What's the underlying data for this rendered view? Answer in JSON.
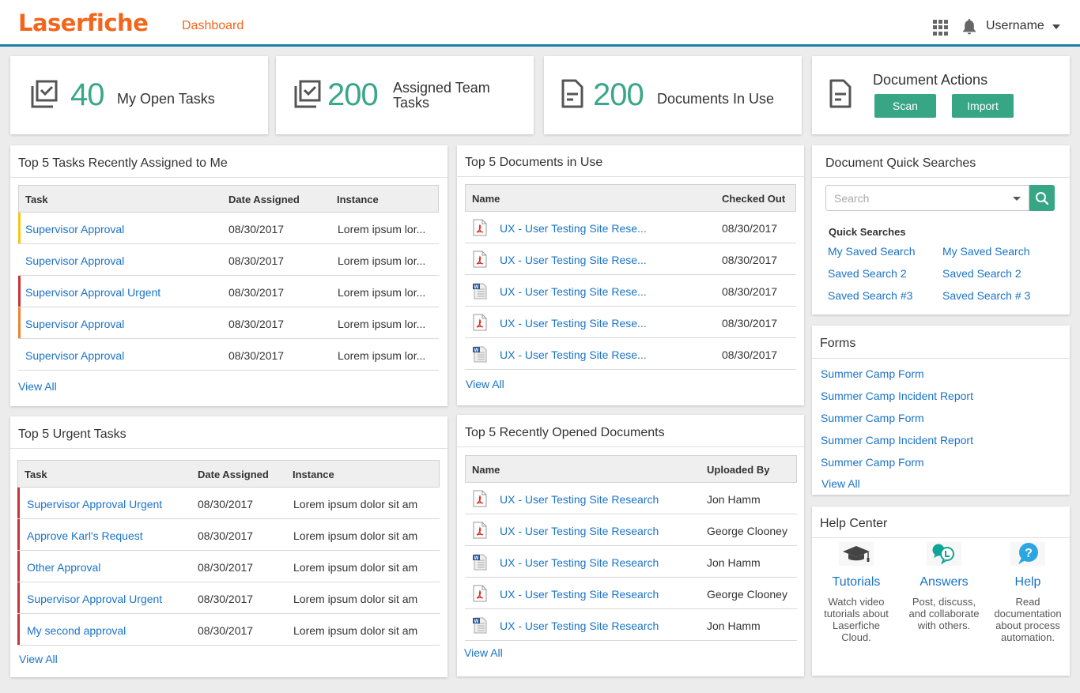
{
  "header": {
    "logo": "Laserfiche",
    "nav_dashboard": "Dashboard",
    "apps_icon": "apps-grid-icon",
    "notifications_icon": "bell-icon",
    "username": "Username"
  },
  "colors": {
    "brand_orange": "#f2661b",
    "accent_green": "#37a685",
    "stat_green": "#3aa68a",
    "link_blue": "#1a73c8",
    "header_border": "#1d7fa6",
    "priority_yellow": "#f5c518",
    "priority_red": "#c8333a",
    "priority_orange": "#f0822d"
  },
  "stats": [
    {
      "icon": "checkbox-tasks-icon",
      "number": "40",
      "label": "My Open Tasks"
    },
    {
      "icon": "checkbox-tasks-icon",
      "number": "200",
      "label_line1": "Assigned Team",
      "label_line2": "Tasks"
    },
    {
      "icon": "document-icon",
      "number": "200",
      "label": "Documents In Use"
    }
  ],
  "document_actions": {
    "icon": "document-icon",
    "title": "Document Actions",
    "scan_label": "Scan",
    "import_label": "Import"
  },
  "recent_tasks": {
    "title": "Top 5 Tasks Recently Assigned to Me",
    "columns": [
      "Task",
      "Date Assigned",
      "Instance"
    ],
    "rows": [
      {
        "task": "Supervisor Approval",
        "date": "08/30/2017",
        "instance": "Lorem ipsum lor...",
        "priority": "yellow"
      },
      {
        "task": "Supervisor Approval",
        "date": "08/30/2017",
        "instance": "Lorem ipsum lor...",
        "priority": "none"
      },
      {
        "task": "Supervisor Approval Urgent",
        "date": "08/30/2017",
        "instance": "Lorem ipsum lor...",
        "priority": "red"
      },
      {
        "task": "Supervisor Approval",
        "date": "08/30/2017",
        "instance": "Lorem ipsum lor...",
        "priority": "orange"
      },
      {
        "task": "Supervisor Approval",
        "date": "08/30/2017",
        "instance": "Lorem ipsum lor...",
        "priority": "none"
      }
    ],
    "view_all": "View All"
  },
  "docs_in_use": {
    "title": "Top 5 Documents in Use",
    "columns": [
      "Name",
      "Checked Out"
    ],
    "rows": [
      {
        "type": "pdf",
        "name": "UX - User Testing Site Rese...",
        "checked_out": "08/30/2017"
      },
      {
        "type": "pdf",
        "name": "UX - User Testing Site Rese...",
        "checked_out": "08/30/2017"
      },
      {
        "type": "word",
        "name": "UX - User Testing Site Rese...",
        "checked_out": "08/30/2017"
      },
      {
        "type": "pdf",
        "name": "UX - User Testing Site Rese...",
        "checked_out": "08/30/2017"
      },
      {
        "type": "word",
        "name": "UX - User Testing Site Rese...",
        "checked_out": "08/30/2017"
      }
    ],
    "view_all": "View All"
  },
  "urgent_tasks": {
    "title": "Top 5 Urgent Tasks",
    "columns": [
      "Task",
      "Date Assigned",
      "Instance"
    ],
    "rows": [
      {
        "task": "Supervisor Approval Urgent",
        "date": "08/30/2017",
        "instance": "Lorem ipsum dolor sit am",
        "priority": "red"
      },
      {
        "task": "Approve Karl's Request",
        "date": "08/30/2017",
        "instance": "Lorem ipsum dolor sit am",
        "priority": "red"
      },
      {
        "task": "Other Approval",
        "date": "08/30/2017",
        "instance": "Lorem ipsum dolor sit am",
        "priority": "red"
      },
      {
        "task": "Supervisor Approval Urgent",
        "date": "08/30/2017",
        "instance": "Lorem ipsum dolor sit am",
        "priority": "red"
      },
      {
        "task": "My second approval",
        "date": "08/30/2017",
        "instance": "Lorem ipsum dolor sit am",
        "priority": "red"
      }
    ],
    "view_all": "View All"
  },
  "recent_docs": {
    "title": "Top 5 Recently Opened Documents",
    "columns": [
      "Name",
      "Uploaded By"
    ],
    "rows": [
      {
        "type": "pdf",
        "name": "UX - User Testing Site Research",
        "uploaded_by": "Jon Hamm"
      },
      {
        "type": "pdf",
        "name": "UX - User Testing Site Research",
        "uploaded_by": "George Clooney"
      },
      {
        "type": "word",
        "name": "UX - User Testing Site Research",
        "uploaded_by": "Jon Hamm"
      },
      {
        "type": "pdf",
        "name": "UX - User Testing Site Research",
        "uploaded_by": "George Clooney"
      },
      {
        "type": "word",
        "name": "UX - User Testing Site Research",
        "uploaded_by": "Jon Hamm"
      }
    ],
    "view_all": "View All"
  },
  "quick_searches": {
    "title": "Document Quick Searches",
    "search_placeholder": "Search",
    "search_value": "",
    "label": "Quick Searches",
    "links": [
      "My Saved Search",
      "My Saved Search",
      "Saved Search 2",
      "Saved Search 2",
      "Saved Search #3",
      "Saved Search # 3"
    ]
  },
  "forms": {
    "title": "Forms",
    "links": [
      "Summer Camp Form",
      "Summer Camp Incident Report",
      "Summer Camp Form",
      "Summer Camp Incident Report",
      "Summer Camp Form"
    ],
    "view_all": "View All"
  },
  "help_center": {
    "title": "Help Center",
    "items": [
      {
        "icon": "graduation-cap-icon",
        "title": "Tutorials",
        "desc": "Watch video tutorials about Laserfiche Cloud."
      },
      {
        "icon": "chat-bubbles-icon",
        "title": "Answers",
        "desc": "Post, discuss, and collaborate with others."
      },
      {
        "icon": "question-bubble-icon",
        "title": "Help",
        "desc": "Read documentation about process automation."
      }
    ]
  }
}
